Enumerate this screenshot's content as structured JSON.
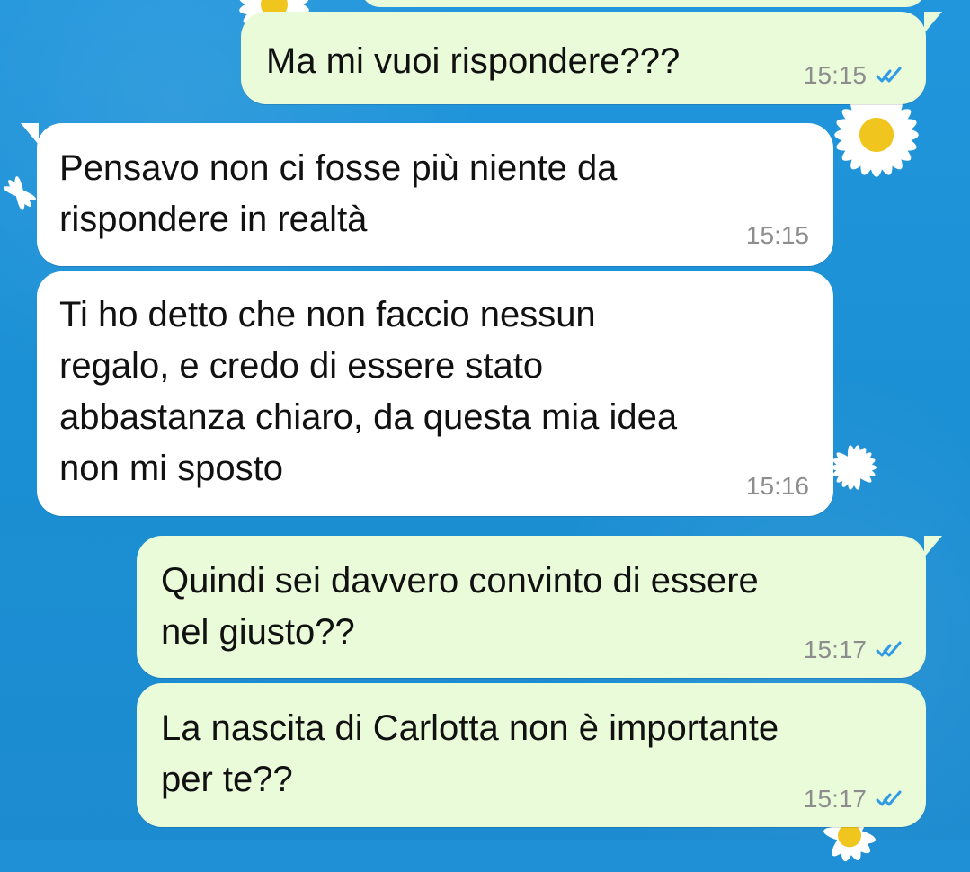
{
  "chat": {
    "messages": [
      {
        "id": "m1",
        "direction": "outgoing",
        "text": "Ma mi vuoi rispondere???",
        "time": "15:15",
        "status_icon": "double-check-icon"
      },
      {
        "id": "m2",
        "direction": "incoming",
        "text": "Pensavo non ci fosse più niente da\nrispondere in realtà",
        "time": "15:15"
      },
      {
        "id": "m3",
        "direction": "incoming",
        "text": "Ti ho detto che non faccio nessun\nregalo, e credo di essere stato\nabbastanza chiaro, da questa mia idea\nnon mi sposto",
        "time": "15:16"
      },
      {
        "id": "m4",
        "direction": "outgoing",
        "text": "Quindi sei davvero convinto di essere\nnel giusto??",
        "time": "15:17",
        "status_icon": "double-check-icon"
      },
      {
        "id": "m5",
        "direction": "outgoing",
        "text": "La nascita di Carlotta non è importante\nper te??",
        "time": "15:17",
        "status_icon": "double-check-icon"
      }
    ]
  },
  "theme": {
    "background": "#1f8fd6",
    "incoming_bubble": "#ffffff",
    "outgoing_bubble": "#e9fbd9",
    "timestamp": "#8d8d8d",
    "read_checks": "#2f9be5"
  }
}
